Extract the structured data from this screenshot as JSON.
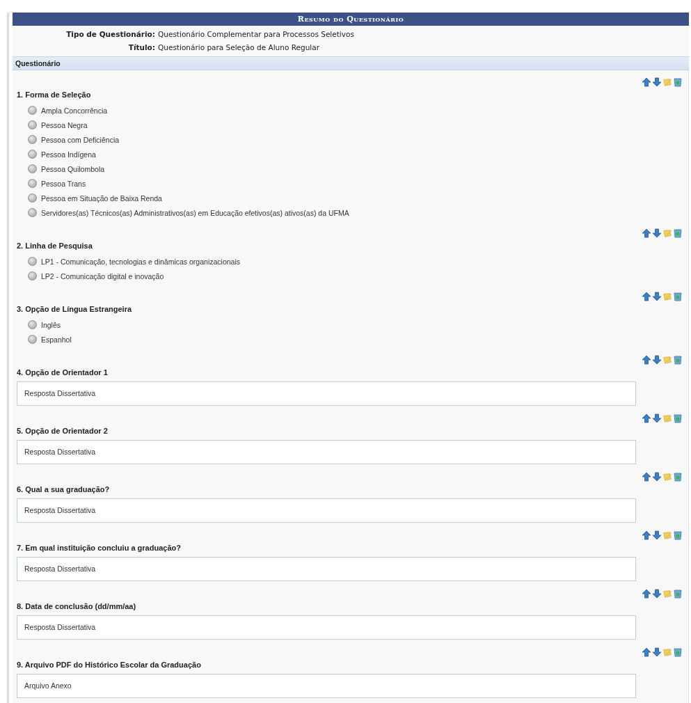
{
  "header": {
    "title": "Resumo do Questionário"
  },
  "info": [
    {
      "label": "Tipo de Questionário:",
      "value": "Questionário Complementar para Processos Seletivos"
    },
    {
      "label": "Título:",
      "value": "Questionário para Seleção de Aluno Regular"
    }
  ],
  "section": {
    "title": "Questionário"
  },
  "questions": [
    {
      "kind": "radio",
      "title": "1. Forma de Seleção",
      "options": [
        {
          "label": "Ampla Concorrência",
          "selected": false
        },
        {
          "label": "Pessoa Negra",
          "selected": false
        },
        {
          "label": "Pessoa com Deficiência",
          "selected": false
        },
        {
          "label": "Pessoa Indígena",
          "selected": false
        },
        {
          "label": "Pessoa Quilombola",
          "selected": false
        },
        {
          "label": "Pessoa Trans",
          "selected": false
        },
        {
          "label": "Pessoa em Situação de Baixa Renda",
          "selected": false
        },
        {
          "label": "Servidores(as) Técnicos(as) Administrativos(as) em Educação efetivos(as) ativos(as) da UFMA",
          "selected": false
        }
      ]
    },
    {
      "kind": "radio",
      "title": "2. Linha de Pesquisa",
      "options": [
        {
          "label": "LP1 - Comunicação, tecnologias e dinâmicas organizacionais",
          "selected": false
        },
        {
          "label": "LP2 - Comunicação digital e inovação",
          "selected": false
        }
      ]
    },
    {
      "kind": "radio",
      "title": "3. Opção de Língua Estrangeira",
      "options": [
        {
          "label": "Inglês",
          "selected": false
        },
        {
          "label": "Espanhol",
          "selected": false
        }
      ]
    },
    {
      "kind": "text",
      "title": "4. Opção de Orientador 1",
      "answer": "Resposta Dissertativa"
    },
    {
      "kind": "text",
      "title": "5. Opção de Orientador 2",
      "answer": "Resposta Dissertativa"
    },
    {
      "kind": "text",
      "title": "6. Qual a sua graduação?",
      "answer": "Resposta Dissertativa"
    },
    {
      "kind": "text",
      "title": "7. Em qual instituição concluiu a graduação?",
      "answer": "Resposta Dissertativa"
    },
    {
      "kind": "text",
      "title": "8. Data de conclusão (dd/mm/aa)",
      "answer": "Resposta Dissertativa"
    },
    {
      "kind": "text",
      "title": "9. Arquivo PDF do Histórico Escolar da Graduação",
      "answer": "Arquivo Anexo"
    }
  ]
}
